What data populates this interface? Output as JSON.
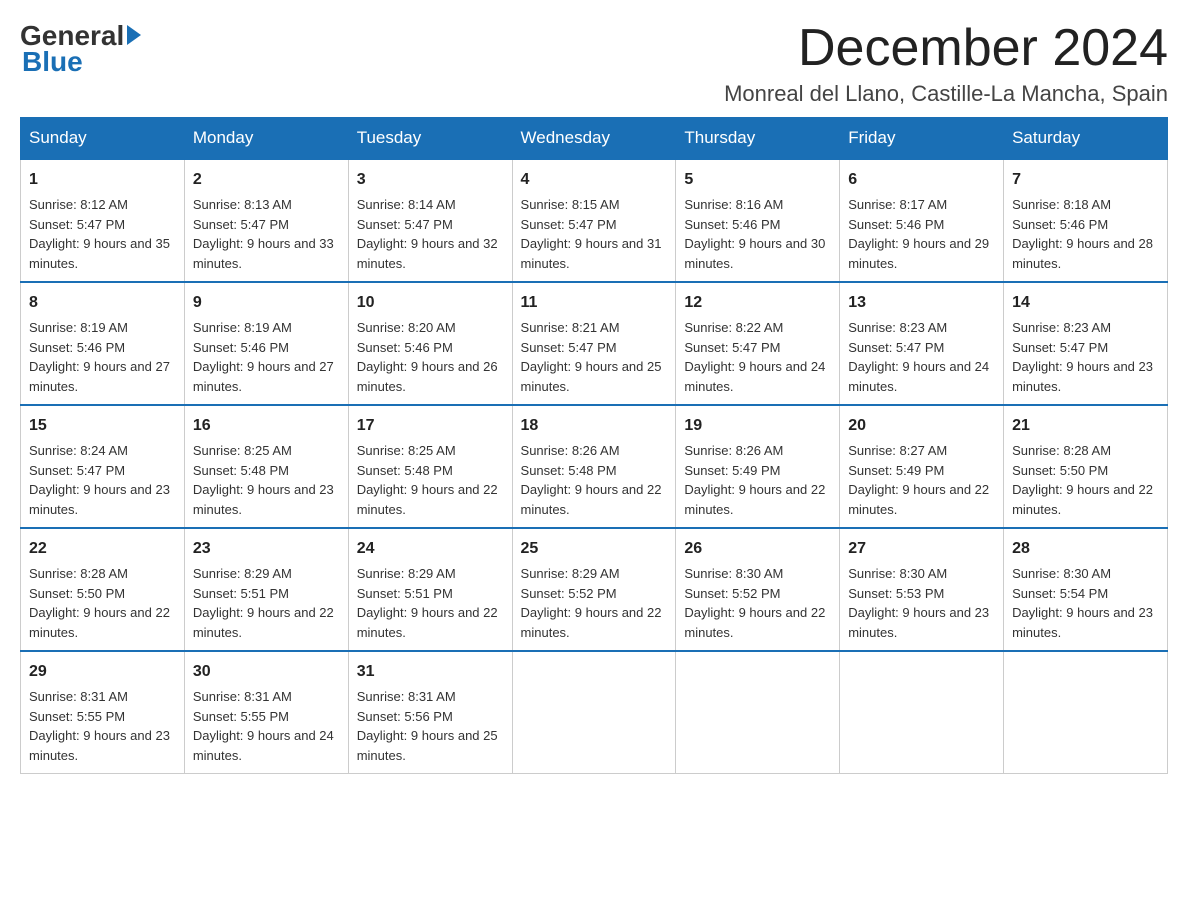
{
  "header": {
    "logo_general": "General",
    "logo_blue": "Blue",
    "month_title": "December 2024",
    "location": "Monreal del Llano, Castille-La Mancha, Spain"
  },
  "days_of_week": [
    "Sunday",
    "Monday",
    "Tuesday",
    "Wednesday",
    "Thursday",
    "Friday",
    "Saturday"
  ],
  "weeks": [
    [
      {
        "day": "1",
        "sunrise": "Sunrise: 8:12 AM",
        "sunset": "Sunset: 5:47 PM",
        "daylight": "Daylight: 9 hours and 35 minutes."
      },
      {
        "day": "2",
        "sunrise": "Sunrise: 8:13 AM",
        "sunset": "Sunset: 5:47 PM",
        "daylight": "Daylight: 9 hours and 33 minutes."
      },
      {
        "day": "3",
        "sunrise": "Sunrise: 8:14 AM",
        "sunset": "Sunset: 5:47 PM",
        "daylight": "Daylight: 9 hours and 32 minutes."
      },
      {
        "day": "4",
        "sunrise": "Sunrise: 8:15 AM",
        "sunset": "Sunset: 5:47 PM",
        "daylight": "Daylight: 9 hours and 31 minutes."
      },
      {
        "day": "5",
        "sunrise": "Sunrise: 8:16 AM",
        "sunset": "Sunset: 5:46 PM",
        "daylight": "Daylight: 9 hours and 30 minutes."
      },
      {
        "day": "6",
        "sunrise": "Sunrise: 8:17 AM",
        "sunset": "Sunset: 5:46 PM",
        "daylight": "Daylight: 9 hours and 29 minutes."
      },
      {
        "day": "7",
        "sunrise": "Sunrise: 8:18 AM",
        "sunset": "Sunset: 5:46 PM",
        "daylight": "Daylight: 9 hours and 28 minutes."
      }
    ],
    [
      {
        "day": "8",
        "sunrise": "Sunrise: 8:19 AM",
        "sunset": "Sunset: 5:46 PM",
        "daylight": "Daylight: 9 hours and 27 minutes."
      },
      {
        "day": "9",
        "sunrise": "Sunrise: 8:19 AM",
        "sunset": "Sunset: 5:46 PM",
        "daylight": "Daylight: 9 hours and 27 minutes."
      },
      {
        "day": "10",
        "sunrise": "Sunrise: 8:20 AM",
        "sunset": "Sunset: 5:46 PM",
        "daylight": "Daylight: 9 hours and 26 minutes."
      },
      {
        "day": "11",
        "sunrise": "Sunrise: 8:21 AM",
        "sunset": "Sunset: 5:47 PM",
        "daylight": "Daylight: 9 hours and 25 minutes."
      },
      {
        "day": "12",
        "sunrise": "Sunrise: 8:22 AM",
        "sunset": "Sunset: 5:47 PM",
        "daylight": "Daylight: 9 hours and 24 minutes."
      },
      {
        "day": "13",
        "sunrise": "Sunrise: 8:23 AM",
        "sunset": "Sunset: 5:47 PM",
        "daylight": "Daylight: 9 hours and 24 minutes."
      },
      {
        "day": "14",
        "sunrise": "Sunrise: 8:23 AM",
        "sunset": "Sunset: 5:47 PM",
        "daylight": "Daylight: 9 hours and 23 minutes."
      }
    ],
    [
      {
        "day": "15",
        "sunrise": "Sunrise: 8:24 AM",
        "sunset": "Sunset: 5:47 PM",
        "daylight": "Daylight: 9 hours and 23 minutes."
      },
      {
        "day": "16",
        "sunrise": "Sunrise: 8:25 AM",
        "sunset": "Sunset: 5:48 PM",
        "daylight": "Daylight: 9 hours and 23 minutes."
      },
      {
        "day": "17",
        "sunrise": "Sunrise: 8:25 AM",
        "sunset": "Sunset: 5:48 PM",
        "daylight": "Daylight: 9 hours and 22 minutes."
      },
      {
        "day": "18",
        "sunrise": "Sunrise: 8:26 AM",
        "sunset": "Sunset: 5:48 PM",
        "daylight": "Daylight: 9 hours and 22 minutes."
      },
      {
        "day": "19",
        "sunrise": "Sunrise: 8:26 AM",
        "sunset": "Sunset: 5:49 PM",
        "daylight": "Daylight: 9 hours and 22 minutes."
      },
      {
        "day": "20",
        "sunrise": "Sunrise: 8:27 AM",
        "sunset": "Sunset: 5:49 PM",
        "daylight": "Daylight: 9 hours and 22 minutes."
      },
      {
        "day": "21",
        "sunrise": "Sunrise: 8:28 AM",
        "sunset": "Sunset: 5:50 PM",
        "daylight": "Daylight: 9 hours and 22 minutes."
      }
    ],
    [
      {
        "day": "22",
        "sunrise": "Sunrise: 8:28 AM",
        "sunset": "Sunset: 5:50 PM",
        "daylight": "Daylight: 9 hours and 22 minutes."
      },
      {
        "day": "23",
        "sunrise": "Sunrise: 8:29 AM",
        "sunset": "Sunset: 5:51 PM",
        "daylight": "Daylight: 9 hours and 22 minutes."
      },
      {
        "day": "24",
        "sunrise": "Sunrise: 8:29 AM",
        "sunset": "Sunset: 5:51 PM",
        "daylight": "Daylight: 9 hours and 22 minutes."
      },
      {
        "day": "25",
        "sunrise": "Sunrise: 8:29 AM",
        "sunset": "Sunset: 5:52 PM",
        "daylight": "Daylight: 9 hours and 22 minutes."
      },
      {
        "day": "26",
        "sunrise": "Sunrise: 8:30 AM",
        "sunset": "Sunset: 5:52 PM",
        "daylight": "Daylight: 9 hours and 22 minutes."
      },
      {
        "day": "27",
        "sunrise": "Sunrise: 8:30 AM",
        "sunset": "Sunset: 5:53 PM",
        "daylight": "Daylight: 9 hours and 23 minutes."
      },
      {
        "day": "28",
        "sunrise": "Sunrise: 8:30 AM",
        "sunset": "Sunset: 5:54 PM",
        "daylight": "Daylight: 9 hours and 23 minutes."
      }
    ],
    [
      {
        "day": "29",
        "sunrise": "Sunrise: 8:31 AM",
        "sunset": "Sunset: 5:55 PM",
        "daylight": "Daylight: 9 hours and 23 minutes."
      },
      {
        "day": "30",
        "sunrise": "Sunrise: 8:31 AM",
        "sunset": "Sunset: 5:55 PM",
        "daylight": "Daylight: 9 hours and 24 minutes."
      },
      {
        "day": "31",
        "sunrise": "Sunrise: 8:31 AM",
        "sunset": "Sunset: 5:56 PM",
        "daylight": "Daylight: 9 hours and 25 minutes."
      },
      null,
      null,
      null,
      null
    ]
  ]
}
